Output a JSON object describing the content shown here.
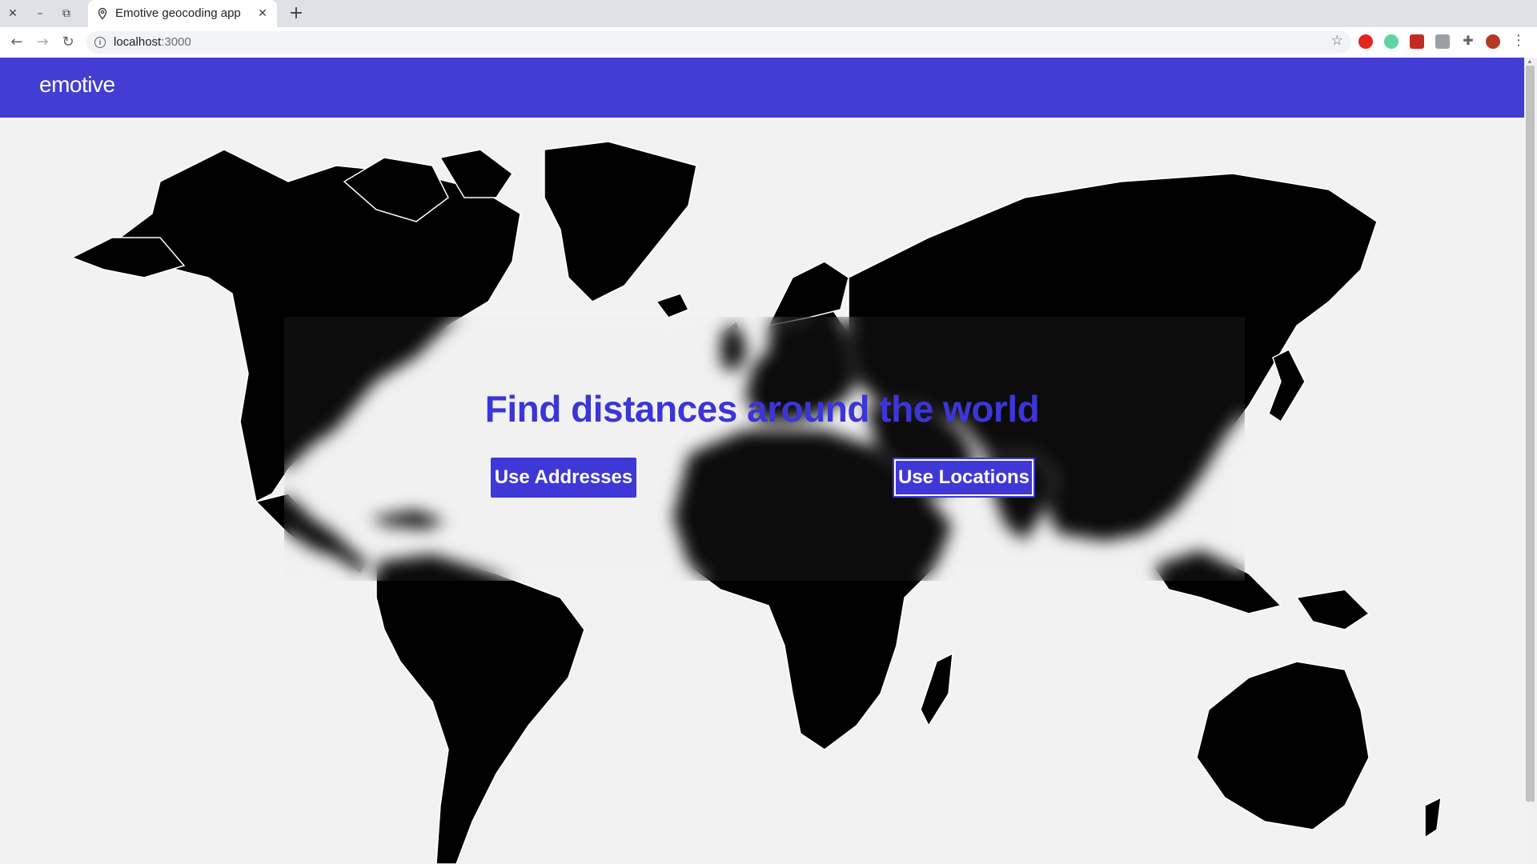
{
  "browser": {
    "tab_title": "Emotive geocoding app",
    "url_host": "localhost",
    "url_port": ":3000",
    "window_controls": {
      "close": "✕",
      "minimize": "–",
      "restore": "⧉"
    },
    "new_tab": "+",
    "nav": {
      "back": "←",
      "forward": "→",
      "reload": "↻"
    },
    "star": "☆",
    "menu": "⋮"
  },
  "app": {
    "brand": "emotive",
    "hero_title": "Find distances around the world",
    "buttons": {
      "use_addresses": "Use Addresses",
      "use_locations": "Use Locations"
    }
  },
  "colors": {
    "navbar": "#443dd4",
    "accent": "#3f38d6",
    "title": "#3c35d8",
    "land": "#000000",
    "background": "#f2f2f2"
  },
  "icons": {
    "tab": "map-pin-icon",
    "info": "info-icon",
    "star": "star-icon",
    "extensions": [
      "opera-icon",
      "extension-green-icon",
      "extension-red-icon",
      "extension-grey-icon",
      "puzzle-icon",
      "profile-avatar"
    ]
  }
}
